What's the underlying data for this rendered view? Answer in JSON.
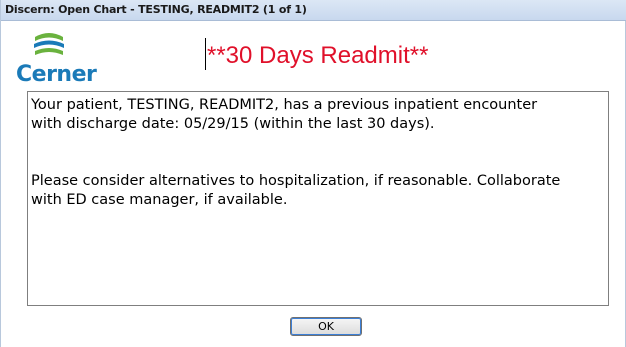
{
  "window": {
    "title": "Discern: Open Chart - TESTING, READMIT2 (1 of 1)"
  },
  "logo": {
    "wordmark": "Cerner",
    "icon": "cerner-logo-icon",
    "colors": {
      "green": "#6ab23e",
      "blue": "#1a7ab8"
    }
  },
  "alert": {
    "headline": "**30 Days Readmit**",
    "headline_color": "#e0102a"
  },
  "message": {
    "line1": "Your patient, TESTING, READMIT2, has a previous inpatient encounter",
    "line2": "with discharge date: 05/29/15 (within the last 30 days).",
    "line3": "Please consider alternatives to hospitalization, if reasonable. Collaborate",
    "line4": "with ED case manager, if available."
  },
  "buttons": {
    "ok_label": "OK"
  }
}
